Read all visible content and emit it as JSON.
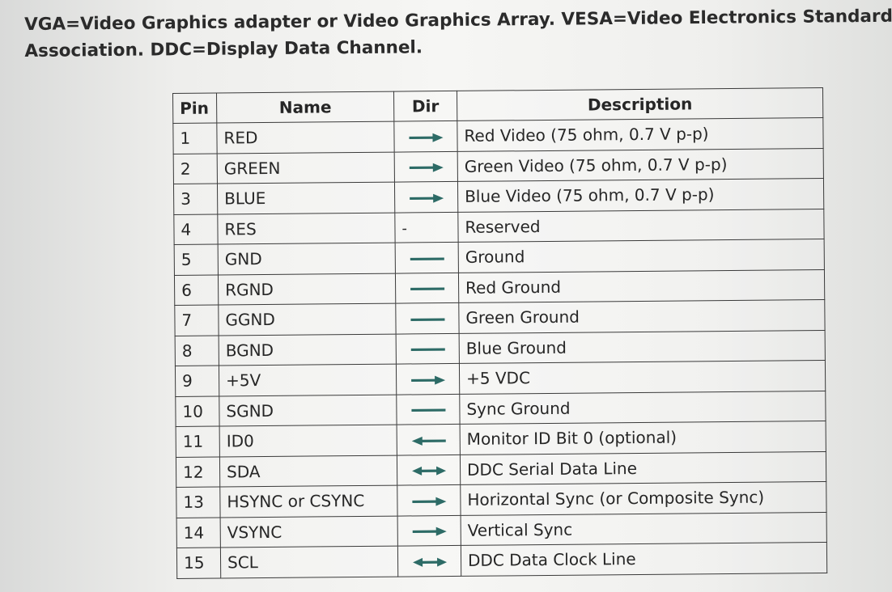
{
  "caption": {
    "line1": "VGA=Video Graphics adapter or Video Graphics Array. VESA=Video Electronics Standards",
    "line2": "Association. DDC=Display Data Channel."
  },
  "colors": {
    "arrow": "#2d6b66",
    "text": "#262626",
    "border": "#3a3a3a"
  },
  "table": {
    "headers": {
      "pin": "Pin",
      "name": "Name",
      "dir": "Dir",
      "description": "Description"
    },
    "rows": [
      {
        "pin": "1",
        "name": "RED",
        "dir": "out",
        "description": "Red Video (75 ohm, 0.7 V p-p)"
      },
      {
        "pin": "2",
        "name": "GREEN",
        "dir": "out",
        "description": "Green Video (75 ohm, 0.7 V p-p)"
      },
      {
        "pin": "3",
        "name": "BLUE",
        "dir": "out",
        "description": "Blue Video (75 ohm, 0.7 V p-p)"
      },
      {
        "pin": "4",
        "name": "RES",
        "dir": "-",
        "description": "Reserved"
      },
      {
        "pin": "5",
        "name": "GND",
        "dir": "line",
        "description": "Ground"
      },
      {
        "pin": "6",
        "name": "RGND",
        "dir": "line",
        "description": "Red Ground"
      },
      {
        "pin": "7",
        "name": "GGND",
        "dir": "line",
        "description": "Green Ground"
      },
      {
        "pin": "8",
        "name": "BGND",
        "dir": "line",
        "description": "Blue Ground"
      },
      {
        "pin": "9",
        "name": "+5V",
        "dir": "out",
        "description": "+5 VDC"
      },
      {
        "pin": "10",
        "name": "SGND",
        "dir": "line",
        "description": "Sync Ground"
      },
      {
        "pin": "11",
        "name": "ID0",
        "dir": "in",
        "description": "Monitor ID Bit 0 (optional)"
      },
      {
        "pin": "12",
        "name": "SDA",
        "dir": "bi",
        "description": "DDC Serial Data Line"
      },
      {
        "pin": "13",
        "name": "HSYNC or CSYNC",
        "dir": "out",
        "description": "Horizontal Sync (or Composite Sync)"
      },
      {
        "pin": "14",
        "name": "VSYNC",
        "dir": "out",
        "description": "Vertical Sync"
      },
      {
        "pin": "15",
        "name": "SCL",
        "dir": "bi",
        "description": "DDC Data Clock Line"
      }
    ]
  }
}
